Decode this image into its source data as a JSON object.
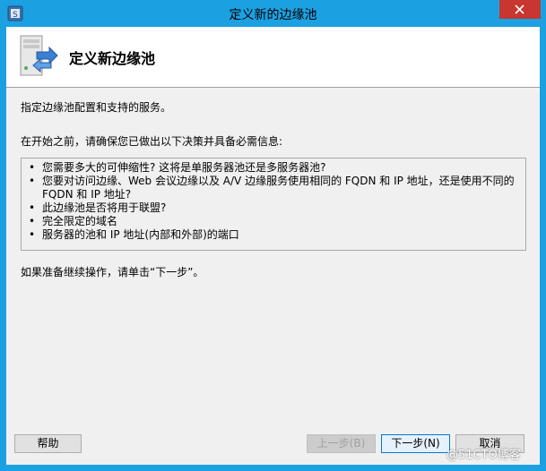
{
  "window": {
    "title": "定义新的边缘池"
  },
  "banner": {
    "title": "定义新边缘池",
    "icon": "server-arrows-icon"
  },
  "body": {
    "intro": "指定边缘池配置和支持的服务。",
    "before_you_begin": "在开始之前，请确保您已做出以下决策并具备必需信息:",
    "bullet": "•",
    "items": [
      {
        "line1": "您需要多大的可伸缩性? 这将是单服务器池还是多服务器池?",
        "line2": ""
      },
      {
        "line1": "您要对访问边缘、Web 会议边缘以及 A/V 边缘服务使用相同的 FQDN 和 IP 地址，还是使用不同的",
        "line2": "FQDN 和 IP 地址?"
      },
      {
        "line1": "此边缘池是否将用于联盟?",
        "line2": ""
      },
      {
        "line1": "完全限定的域名",
        "line2": ""
      },
      {
        "line1": "服务器的池和 IP 地址(内部和外部)的端口",
        "line2": ""
      }
    ],
    "ready": "如果准备继续操作，请单击“下一步”。"
  },
  "buttons": {
    "help": "帮助",
    "back": "上一步(B)",
    "next": "下一步(N)",
    "cancel": "取消"
  },
  "watermark": "@51CTO博客",
  "colors": {
    "titlebar": "#1ba1e2",
    "close": "#c7372f",
    "client_bg": "#f0f0f0"
  }
}
